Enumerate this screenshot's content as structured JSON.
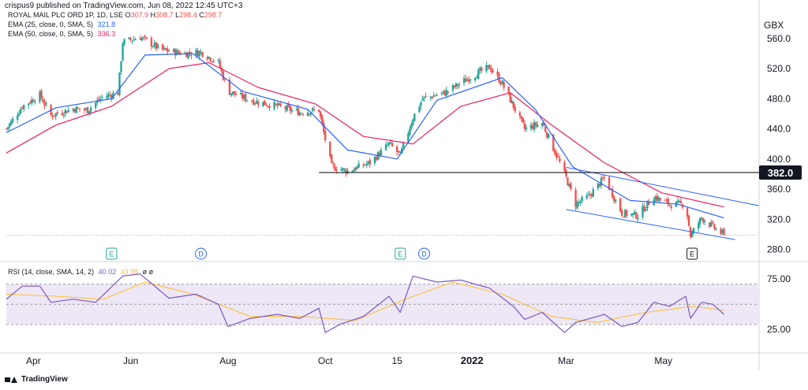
{
  "attribution": "crispus9 published on TradingView.com, Jun 08, 2022 12:45 UTC+3",
  "brand": "TradingView",
  "legend": {
    "symbol": "ROYAL MAIL PLC ORD 1P, 1D, LSE",
    "ohlc": [
      {
        "k": "O",
        "v": "307.9"
      },
      {
        "k": "H",
        "v": "308.7"
      },
      {
        "k": "L",
        "v": "298.4"
      },
      {
        "k": "C",
        "v": "298.7"
      }
    ],
    "ema25_label": "EMA (25, close, 0, SMA, 5)",
    "ema25_value": "321.8",
    "ema50_label": "EMA (50, close, 0, SMA, 5)",
    "ema50_value": "336.3"
  },
  "rsi_legend": {
    "label": "RSI (14, close, SMA, 14, 2)",
    "value1": "40.02",
    "value2": "43.98",
    "extra": "ø ø"
  },
  "events": [
    {
      "label": "E",
      "date": "2021-05-20"
    },
    {
      "label": "D",
      "date": "2021-07-15"
    },
    {
      "label": "E",
      "date": "2021-11-17"
    },
    {
      "label": "D",
      "date": "2021-12-02"
    },
    {
      "label": "E",
      "date": "2022-05-19"
    }
  ],
  "colors": {
    "up": "#26a69a",
    "down": "#ef5350",
    "ema25": "#2962ff",
    "ema50": "#e91e63",
    "rsi": "#7e57c2",
    "rsi_ma": "#fbc02d",
    "rsi_band": "#ede7f6",
    "trend": "#2962ff",
    "level": "#000000"
  },
  "chart_data": [
    {
      "type": "candlestick",
      "title": "ROYAL MAIL PLC ORD 1P, 1D, LSE",
      "ylabel": "GBX",
      "ylim": [
        268,
        585
      ],
      "x_range": [
        "2021-03-15",
        "2022-06-30"
      ],
      "x_ticks": [
        {
          "date": "2021-04-01",
          "label": "Apr"
        },
        {
          "date": "2021-06-01",
          "label": "Jun"
        },
        {
          "date": "2021-08-01",
          "label": "Aug"
        },
        {
          "date": "2021-10-01",
          "label": "Oct"
        },
        {
          "date": "2021-11-15",
          "label": "15"
        },
        {
          "date": "2022-01-01",
          "label": "2022"
        },
        {
          "date": "2022-03-01",
          "label": "Mar"
        },
        {
          "date": "2022-05-01",
          "label": "May"
        }
      ],
      "y_ticks": [
        280,
        320,
        360,
        400,
        440,
        480,
        520,
        560
      ],
      "highlighted_level": {
        "value": 382.0,
        "label": "382.0",
        "start": "2021-09-27"
      },
      "price_curve": [
        [
          "2021-03-15",
          440
        ],
        [
          "2021-03-25",
          470
        ],
        [
          "2021-04-05",
          485
        ],
        [
          "2021-04-12",
          458
        ],
        [
          "2021-04-26",
          467
        ],
        [
          "2021-05-05",
          465
        ],
        [
          "2021-05-14",
          482
        ],
        [
          "2021-05-24",
          488
        ],
        [
          "2021-05-27",
          555
        ],
        [
          "2021-06-07",
          562
        ],
        [
          "2021-06-20",
          545
        ],
        [
          "2021-07-05",
          540
        ],
        [
          "2021-07-15",
          542
        ],
        [
          "2021-07-26",
          528
        ],
        [
          "2021-08-01",
          490
        ],
        [
          "2021-08-15",
          478
        ],
        [
          "2021-09-01",
          470
        ],
        [
          "2021-09-15",
          462
        ],
        [
          "2021-09-27",
          465
        ],
        [
          "2021-09-30",
          435
        ],
        [
          "2021-10-05",
          390
        ],
        [
          "2021-10-15",
          384
        ],
        [
          "2021-10-29",
          395
        ],
        [
          "2021-11-10",
          420
        ],
        [
          "2021-11-17",
          405
        ],
        [
          "2021-11-25",
          455
        ],
        [
          "2021-12-01",
          480
        ],
        [
          "2021-12-15",
          488
        ],
        [
          "2022-01-01",
          510
        ],
        [
          "2022-01-12",
          522
        ],
        [
          "2022-01-20",
          500
        ],
        [
          "2022-01-27",
          470
        ],
        [
          "2022-02-03",
          440
        ],
        [
          "2022-02-14",
          448
        ],
        [
          "2022-02-24",
          400
        ],
        [
          "2022-03-01",
          375
        ],
        [
          "2022-03-07",
          340
        ],
        [
          "2022-03-15",
          350
        ],
        [
          "2022-03-25",
          375
        ],
        [
          "2022-04-05",
          328
        ],
        [
          "2022-04-15",
          325
        ],
        [
          "2022-04-25",
          350
        ],
        [
          "2022-05-05",
          340
        ],
        [
          "2022-05-15",
          340
        ],
        [
          "2022-05-18",
          298
        ],
        [
          "2022-05-25",
          322
        ],
        [
          "2022-06-01",
          310
        ],
        [
          "2022-06-08",
          298.7
        ]
      ],
      "ema25": [
        [
          "2021-03-15",
          435
        ],
        [
          "2021-04-15",
          468
        ],
        [
          "2021-05-20",
          480
        ],
        [
          "2021-06-10",
          538
        ],
        [
          "2021-07-10",
          540
        ],
        [
          "2021-08-10",
          490
        ],
        [
          "2021-09-20",
          466
        ],
        [
          "2021-10-15",
          412
        ],
        [
          "2021-11-15",
          400
        ],
        [
          "2021-12-10",
          478
        ],
        [
          "2022-01-20",
          508
        ],
        [
          "2022-02-10",
          465
        ],
        [
          "2022-03-05",
          390
        ],
        [
          "2022-04-10",
          345
        ],
        [
          "2022-05-10",
          340
        ],
        [
          "2022-06-08",
          321.8
        ]
      ],
      "ema50": [
        [
          "2021-03-15",
          408
        ],
        [
          "2021-04-15",
          445
        ],
        [
          "2021-05-20",
          470
        ],
        [
          "2021-06-25",
          520
        ],
        [
          "2021-07-20",
          528
        ],
        [
          "2021-08-20",
          495
        ],
        [
          "2021-09-25",
          473
        ],
        [
          "2021-10-25",
          430
        ],
        [
          "2021-11-25",
          420
        ],
        [
          "2021-12-25",
          470
        ],
        [
          "2022-01-25",
          488
        ],
        [
          "2022-02-20",
          445
        ],
        [
          "2022-03-25",
          395
        ],
        [
          "2022-04-30",
          355
        ],
        [
          "2022-06-08",
          336.3
        ]
      ],
      "trendlines": [
        {
          "from": [
            "2022-03-01",
            389
          ],
          "to": [
            "2022-06-30",
            338
          ]
        },
        {
          "from": [
            "2022-03-01",
            333
          ],
          "to": [
            "2022-06-15",
            293
          ]
        }
      ]
    },
    {
      "type": "line",
      "title": "RSI (14, close, SMA, 14, 2)",
      "ylim": [
        8,
        90
      ],
      "y_ticks": [
        25.0,
        75.0
      ],
      "band": [
        30,
        70
      ],
      "midline": 50,
      "rsi": [
        [
          "2021-03-15",
          55
        ],
        [
          "2021-03-25",
          68
        ],
        [
          "2021-04-05",
          68
        ],
        [
          "2021-04-12",
          52
        ],
        [
          "2021-04-26",
          55
        ],
        [
          "2021-05-10",
          52
        ],
        [
          "2021-05-27",
          78
        ],
        [
          "2021-06-07",
          80
        ],
        [
          "2021-06-25",
          56
        ],
        [
          "2021-07-12",
          60
        ],
        [
          "2021-07-26",
          50
        ],
        [
          "2021-08-01",
          28
        ],
        [
          "2021-08-15",
          36
        ],
        [
          "2021-09-01",
          40
        ],
        [
          "2021-09-15",
          36
        ],
        [
          "2021-09-27",
          46
        ],
        [
          "2021-10-01",
          22
        ],
        [
          "2021-10-10",
          30
        ],
        [
          "2021-10-25",
          38
        ],
        [
          "2021-11-10",
          58
        ],
        [
          "2021-11-17",
          42
        ],
        [
          "2021-11-25",
          78
        ],
        [
          "2021-12-10",
          72
        ],
        [
          "2021-12-25",
          74
        ],
        [
          "2022-01-12",
          66
        ],
        [
          "2022-01-27",
          48
        ],
        [
          "2022-02-03",
          35
        ],
        [
          "2022-02-14",
          42
        ],
        [
          "2022-02-28",
          22
        ],
        [
          "2022-03-07",
          32
        ],
        [
          "2022-03-25",
          40
        ],
        [
          "2022-04-05",
          28
        ],
        [
          "2022-04-15",
          32
        ],
        [
          "2022-04-25",
          52
        ],
        [
          "2022-05-05",
          48
        ],
        [
          "2022-05-15",
          58
        ],
        [
          "2022-05-18",
          36
        ],
        [
          "2022-05-25",
          52
        ],
        [
          "2022-06-01",
          50
        ],
        [
          "2022-06-08",
          40
        ]
      ],
      "rsi_ma": [
        [
          "2021-03-15",
          60
        ],
        [
          "2021-04-15",
          58
        ],
        [
          "2021-05-15",
          55
        ],
        [
          "2021-06-10",
          72
        ],
        [
          "2021-07-10",
          60
        ],
        [
          "2021-08-15",
          38
        ],
        [
          "2021-09-15",
          38
        ],
        [
          "2021-10-20",
          34
        ],
        [
          "2021-11-20",
          55
        ],
        [
          "2021-12-20",
          72
        ],
        [
          "2022-01-20",
          60
        ],
        [
          "2022-02-20",
          38
        ],
        [
          "2022-03-20",
          32
        ],
        [
          "2022-04-20",
          42
        ],
        [
          "2022-05-20",
          48
        ],
        [
          "2022-06-08",
          44
        ]
      ]
    }
  ]
}
